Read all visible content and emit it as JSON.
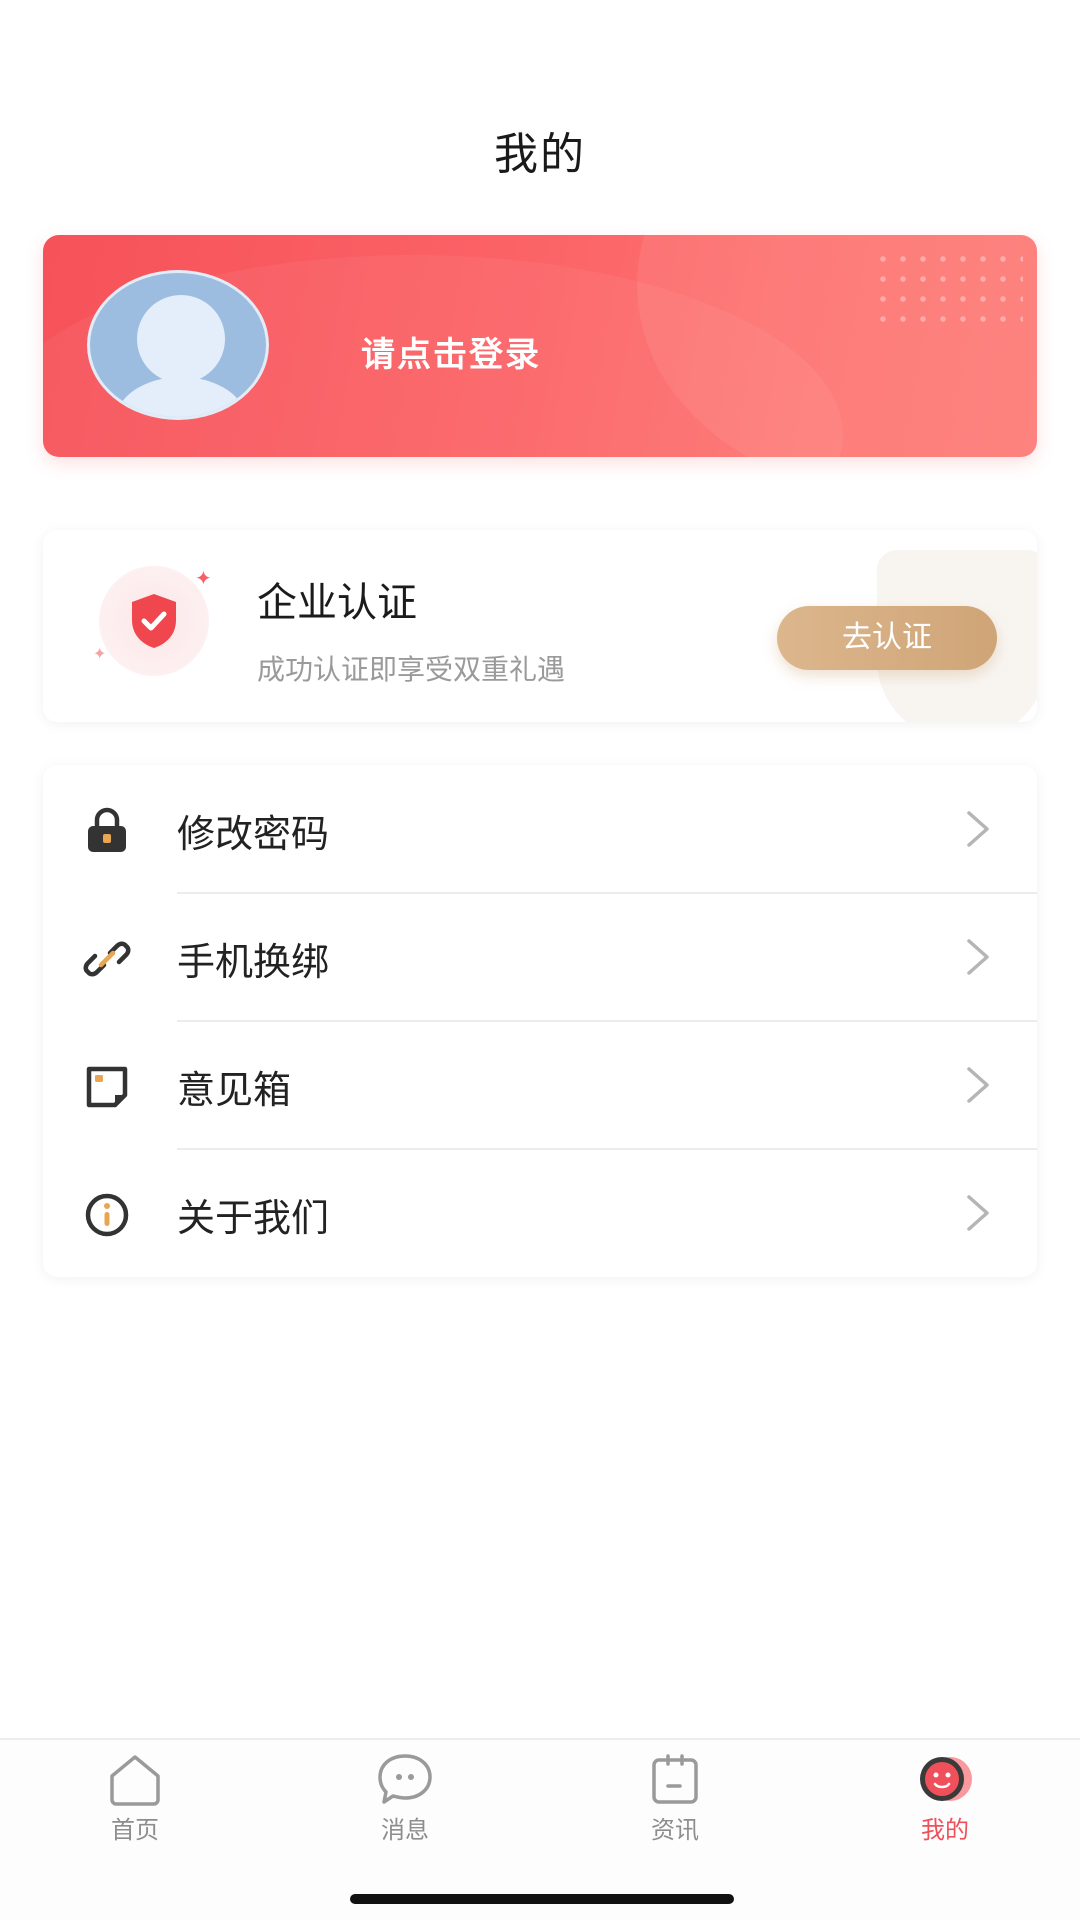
{
  "header": {
    "title": "我的"
  },
  "profile": {
    "login_prompt": "请点击登录"
  },
  "certification": {
    "title": "企业认证",
    "subtitle": "成功认证即享受双重礼遇",
    "button_label": "去认证"
  },
  "menu": {
    "items": [
      {
        "label": "修改密码",
        "icon": "lock-icon"
      },
      {
        "label": "手机换绑",
        "icon": "link-icon"
      },
      {
        "label": "意见箱",
        "icon": "note-icon"
      },
      {
        "label": "关于我们",
        "icon": "info-icon"
      }
    ]
  },
  "tabbar": {
    "tabs": [
      {
        "label": "首页",
        "icon": "home-icon"
      },
      {
        "label": "消息",
        "icon": "message-icon"
      },
      {
        "label": "资讯",
        "icon": "news-icon"
      },
      {
        "label": "我的",
        "icon": "profile-icon",
        "active": true
      }
    ]
  },
  "colors": {
    "primary_red": "#f65259",
    "gold": "#d4ad80",
    "icon_accent": "#e8a652"
  }
}
